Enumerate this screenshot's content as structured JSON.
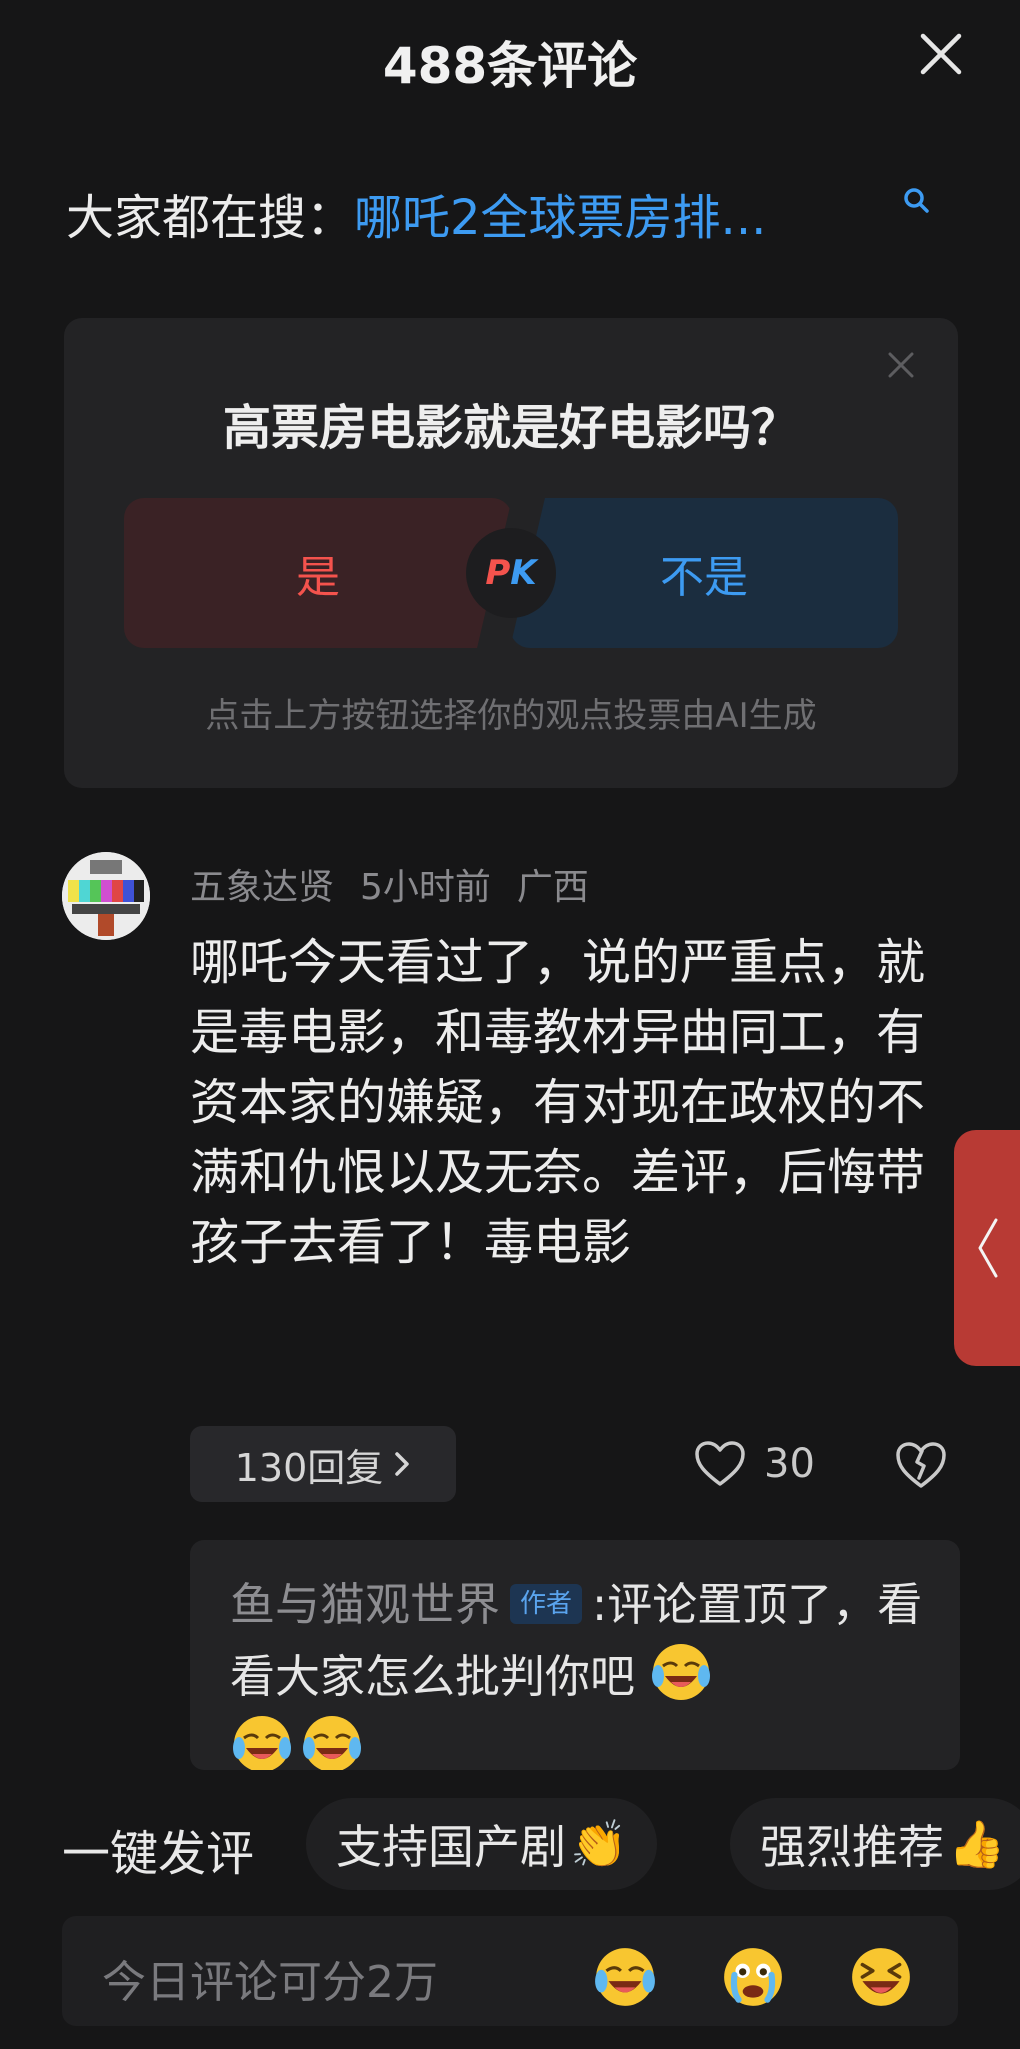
{
  "header": {
    "title": "488条评论"
  },
  "trending": {
    "prefix": "大家都在搜：",
    "query": "哪吒2全球票房排..."
  },
  "poll": {
    "question": "高票房电影就是好电影吗？",
    "option_yes": "是",
    "option_no": "不是",
    "pk_p": "P",
    "pk_k": "K",
    "footer": "点击上方按钮选择你的观点投票由AI生成"
  },
  "comment": {
    "username": "五象达贤",
    "time": "5小时前",
    "location": "广西",
    "text": "哪吒今天看过了，说的严重点，就是毒电影，和毒教材异曲同工，有资本家的嫌疑，有对现在政权的不满和仇恨以及无奈。差评，后悔带孩子去看了！毒电影",
    "reply_count_label": "130回复",
    "likes": "30"
  },
  "author_reply": {
    "author": "鱼与猫观世界",
    "badge": "作者",
    "text": ":评论置顶了，看看大家怎么批判你吧"
  },
  "quick_bar": {
    "label": "一键发评",
    "chips": [
      {
        "text": "支持国产剧",
        "emoji": "👏"
      },
      {
        "text": "强烈推荐",
        "emoji": "👍"
      }
    ]
  },
  "input": {
    "placeholder": "今日评论可分2万"
  },
  "colors": {
    "background": "#161617",
    "accent_blue": "#3d9bf2",
    "accent_red": "#f4534d",
    "side_tab": "#b83a34"
  }
}
